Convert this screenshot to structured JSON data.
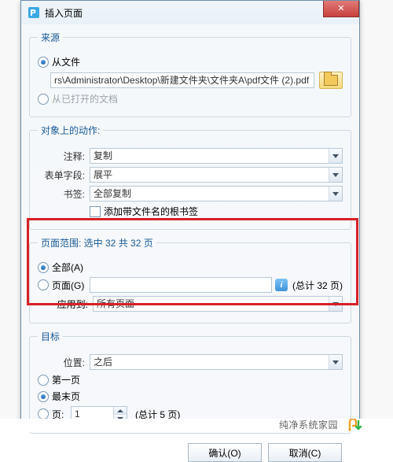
{
  "window": {
    "title": "插入页面",
    "close_glyph": "✕"
  },
  "source": {
    "legend": "来源",
    "from_file_label": "从文件",
    "file_path": "rs\\Administrator\\Desktop\\新建文件夹\\文件夹A\\pdf文件 (2).pdf",
    "from_open_docs_label": "从已打开的文档"
  },
  "actions": {
    "legend": "对象上的动作:",
    "annot_label": "注释:",
    "annot_value": "复制",
    "formfield_label": "表单字段:",
    "formfield_value": "展平",
    "bookmark_label": "书签:",
    "bookmark_value": "全部复制",
    "bookmark_checkbox_label": "添加带文件名的根书签"
  },
  "page_range": {
    "legend_prefix": "页面范围: ",
    "legend_mid": "选中 32 共 32 页",
    "all_label": "全部(A)",
    "pages_label": "页面(G)",
    "pages_value": "",
    "info_glyph": "i",
    "total_text": "(总计 32 页)",
    "apply_to_label": "应用到:",
    "apply_to_value": "所有页面"
  },
  "target": {
    "legend": "目标",
    "position_label": "位置:",
    "position_value": "之后",
    "first_page_label": "第一页",
    "last_page_label": "最末页",
    "page_label": "页:",
    "page_value": "1",
    "total_text": "(总计 5 页)"
  },
  "buttons": {
    "ok": "确认(O)",
    "cancel": "取消(C)"
  },
  "watermark": {
    "brand": "纯净系统家园"
  }
}
